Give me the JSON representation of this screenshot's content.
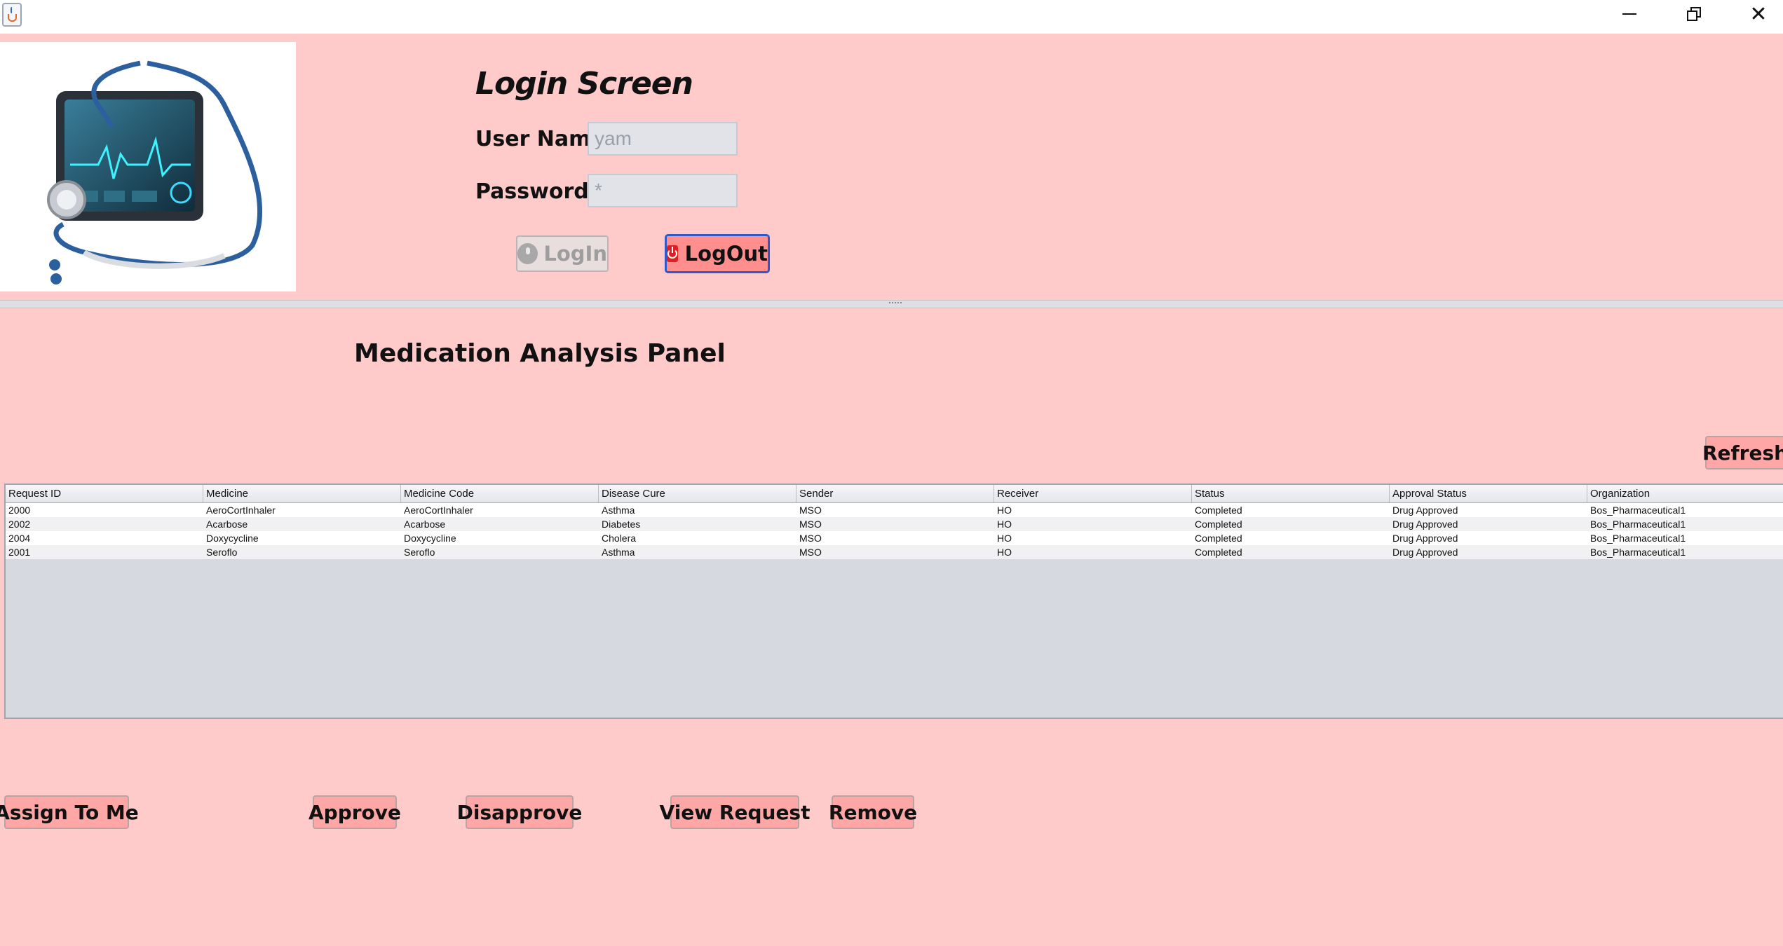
{
  "window": {
    "icon": "java-cup-icon",
    "controls": {
      "minimize": "minimize-icon",
      "maximize": "restore-icon",
      "close": "close-icon"
    }
  },
  "login": {
    "title": "Login Screen",
    "username_label": "User Name :",
    "username_value": "yam",
    "password_label": "Password:",
    "password_value": "*",
    "login_button": "LogIn",
    "logout_button": "LogOut"
  },
  "panel": {
    "title": "Medication Analysis Panel",
    "refresh_button": "Refresh"
  },
  "table": {
    "columns": [
      "Request ID",
      "Medicine",
      "Medicine Code",
      "Disease Cure",
      "Sender",
      "Receiver",
      "Status",
      "Approval Status",
      "Organization"
    ],
    "rows": [
      [
        "2000",
        "AeroCortInhaler",
        "AeroCortInhaler",
        "Asthma",
        "MSO",
        "HO",
        "Completed",
        "Drug Approved",
        "Bos_Pharmaceutical1"
      ],
      [
        "2002",
        "Acarbose",
        "Acarbose",
        "Diabetes",
        "MSO",
        "HO",
        "Completed",
        "Drug Approved",
        "Bos_Pharmaceutical1"
      ],
      [
        "2004",
        "Doxycycline",
        "Doxycycline",
        "Cholera",
        "MSO",
        "HO",
        "Completed",
        "Drug Approved",
        "Bos_Pharmaceutical1"
      ],
      [
        "2001",
        "Seroflo",
        "Seroflo",
        "Asthma",
        "MSO",
        "HO",
        "Completed",
        "Drug Approved",
        "Bos_Pharmaceutical1"
      ]
    ]
  },
  "actions": {
    "assign": "Assign To Me",
    "approve": "Approve",
    "disapprove": "Disapprove",
    "view": "View Request",
    "remove": "Remove"
  },
  "colors": {
    "background": "#ffcaca",
    "button": "#ffa6a6",
    "logout_button": "#ff8f8f",
    "focus_border": "#2f58c8"
  }
}
